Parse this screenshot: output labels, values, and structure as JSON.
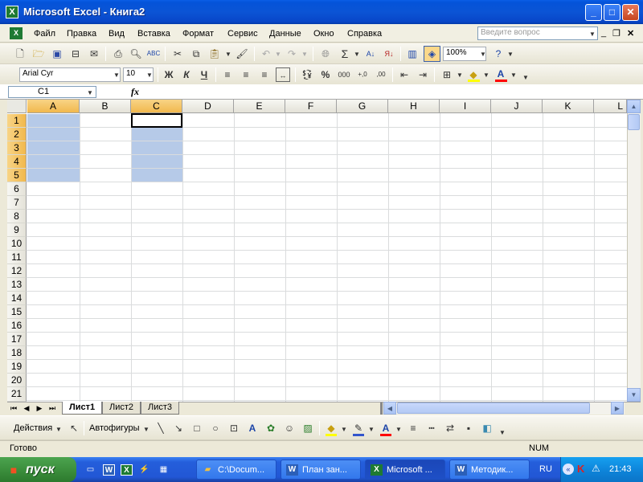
{
  "window": {
    "title": "Microsoft Excel - Книга2",
    "app_icon": "X"
  },
  "window_buttons": {
    "minimize": "_",
    "maximize": "□",
    "close": "✕"
  },
  "menu": [
    "Файл",
    "Правка",
    "Вид",
    "Вставка",
    "Формат",
    "Сервис",
    "Данные",
    "Окно",
    "Справка"
  ],
  "help_box": {
    "placeholder": "Введите вопрос"
  },
  "standard_toolbar": {
    "zoom": "100%",
    "icons": [
      "new-icon",
      "open-icon",
      "save-icon",
      "permission-icon",
      "email-icon",
      "print-icon",
      "print-preview-icon",
      "spelling-icon",
      "cut-icon",
      "copy-icon",
      "paste-icon",
      "format-painter-icon",
      "undo-icon",
      "redo-icon",
      "hyperlink-icon",
      "autosum-icon",
      "sort-ascending-icon",
      "sort-descending-icon",
      "chart-wizard-icon",
      "drawing-icon",
      "help-icon"
    ]
  },
  "format_toolbar": {
    "font": "Arial Cyr",
    "size": "10",
    "bold": "Ж",
    "italic": "К",
    "underline": "Ч",
    "percent": "%",
    "thousands": "000"
  },
  "formula_bar": {
    "name_box": "C1",
    "fx": "fx",
    "formula": ""
  },
  "columns": [
    "A",
    "B",
    "C",
    "D",
    "E",
    "F",
    "G",
    "H",
    "I",
    "J",
    "K",
    "L"
  ],
  "selected_columns": [
    "A",
    "C"
  ],
  "rows": [
    "1",
    "2",
    "3",
    "4",
    "5",
    "6",
    "7",
    "8",
    "9",
    "10",
    "11",
    "12",
    "13",
    "14",
    "15",
    "16",
    "17",
    "18",
    "19",
    "20",
    "21"
  ],
  "selected_rows": [
    "1",
    "2",
    "3",
    "4",
    "5"
  ],
  "active_cell": "C1",
  "selection": "A1:A5, C1:C5",
  "sheets": [
    {
      "label": "Лист1",
      "active": true
    },
    {
      "label": "Лист2",
      "active": false
    },
    {
      "label": "Лист3",
      "active": false
    }
  ],
  "drawing_toolbar": {
    "actions": "Действия",
    "autoshapes": "Автофигуры"
  },
  "status": {
    "text": "Готово",
    "num": "NUM"
  },
  "taskbar": {
    "start": "пуск",
    "quick_launch": [
      "desktop-icon",
      "word-icon",
      "excel-icon",
      "winamp-icon",
      "calc-icon"
    ],
    "tasks": [
      {
        "label": "C:\\Docum...",
        "icon": "folder-icon",
        "active": false
      },
      {
        "label": "План зан...",
        "icon": "word-icon",
        "active": false
      },
      {
        "label": "Microsoft ...",
        "icon": "excel-icon",
        "active": true
      },
      {
        "label": "Методик...",
        "icon": "word-icon",
        "active": false
      }
    ],
    "language": "RU",
    "clock": "21:43"
  },
  "colors": {
    "selection": "#b6cae8",
    "header_selected": "#f1b84d",
    "taskbar": "#245edb",
    "start": "#3c8f3d"
  }
}
